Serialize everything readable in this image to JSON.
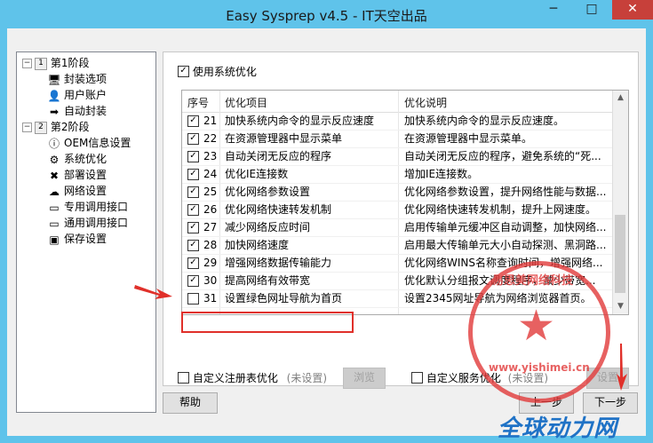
{
  "window": {
    "title": "Easy Sysprep v4.5 - IT天空出品",
    "min_glyph": "─",
    "max_glyph": "□",
    "close_glyph": "✕"
  },
  "tree": {
    "stages": [
      {
        "no": "1",
        "label": "第1阶段",
        "items": [
          {
            "label": "封装选项",
            "icon": "monitor-icon",
            "glyph": "🖥"
          },
          {
            "label": "用户账户",
            "icon": "user-icon",
            "glyph": "👤"
          },
          {
            "label": "自动封装",
            "icon": "arrow-icon",
            "glyph": "➡"
          }
        ]
      },
      {
        "no": "2",
        "label": "第2阶段",
        "items": [
          {
            "label": "OEM信息设置",
            "icon": "info-icon",
            "glyph": "ⓘ"
          },
          {
            "label": "系统优化",
            "icon": "gear-icon",
            "glyph": "⚙"
          },
          {
            "label": "部署设置",
            "icon": "deploy-icon",
            "glyph": "✖"
          },
          {
            "label": "网络设置",
            "icon": "network-icon",
            "glyph": "☁"
          },
          {
            "label": "专用调用接口",
            "icon": "terminal-icon",
            "glyph": "▭"
          },
          {
            "label": "通用调用接口",
            "icon": "terminal-icon",
            "glyph": "▭"
          },
          {
            "label": "保存设置",
            "icon": "save-icon",
            "glyph": "▣"
          }
        ]
      }
    ],
    "collapse_glyph": "−"
  },
  "optimize": {
    "enable_label": "使用系统优化",
    "enable_checked": true,
    "columns": [
      "序号",
      "优化项目",
      "优化说明"
    ],
    "rows": [
      {
        "checked": true,
        "no": "21",
        "item": "加快系统内命令的显示反应速度",
        "desc": "加快系统内命令的显示反应速度。"
      },
      {
        "checked": true,
        "no": "22",
        "item": "在资源管理器中显示菜单",
        "desc": "在资源管理器中显示菜单。"
      },
      {
        "checked": true,
        "no": "23",
        "item": "自动关闭无反应的程序",
        "desc": "自动关闭无反应的程序，避免系统的“死..."
      },
      {
        "checked": true,
        "no": "24",
        "item": "优化IE连接数",
        "desc": "增加IE连接数。"
      },
      {
        "checked": true,
        "no": "25",
        "item": "优化网络参数设置",
        "desc": "优化网络参数设置，提升网络性能与数据..."
      },
      {
        "checked": true,
        "no": "26",
        "item": "优化网络快速转发机制",
        "desc": "优化网络快速转发机制，提升上网速度。"
      },
      {
        "checked": true,
        "no": "27",
        "item": "减少网络反应时间",
        "desc": "启用传输单元缓冲区自动调整，加快网络..."
      },
      {
        "checked": true,
        "no": "28",
        "item": "加快网络速度",
        "desc": "启用最大传输单元大小自动探测、黑洞路..."
      },
      {
        "checked": true,
        "no": "29",
        "item": "增强网络数据传输能力",
        "desc": "优化网络WINS名称查询时间，增强网络..."
      },
      {
        "checked": true,
        "no": "30",
        "item": "提高网络有效带宽",
        "desc": "优化默认分组报文调度程序，减少带宽..."
      },
      {
        "checked": false,
        "no": "31",
        "item": "设置绿色网址导航为首页",
        "desc": "设置2345网址导航为网络浏览器首页。"
      }
    ],
    "check_glyph": "✓",
    "scroll_up": "▲",
    "scroll_down": "▼"
  },
  "custom": {
    "registry_label": "自定义注册表优化",
    "registry_status": "(未设置)",
    "browse_label": "浏览",
    "service_label": "自定义服务优化",
    "service_status": "(未设置)",
    "setup_label": "设置"
  },
  "footer": {
    "help_label": "帮助",
    "prev_label": "上一步",
    "next_label": "下一步"
  },
  "watermark": {
    "stamp_top": "易思美网络科技",
    "stamp_bottom": "www.yishimei.cn",
    "stamp_star": "★",
    "brand": "全球动力网"
  },
  "colors": {
    "accent": "#5fc3ea",
    "highlight": "#e0302a"
  }
}
